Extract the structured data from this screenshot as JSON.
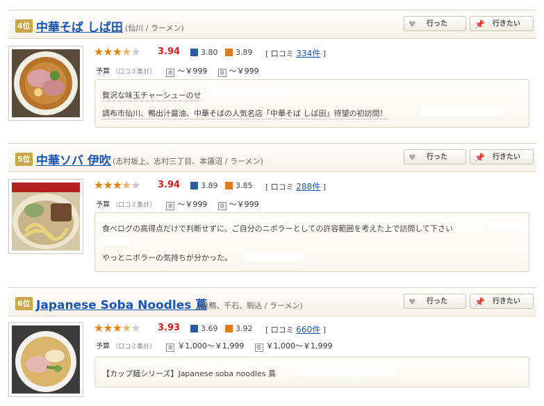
{
  "colors": {
    "link": "#1a55b0",
    "score": "#d01d1d",
    "star": "#e2830f",
    "rank_bg": "#c9a54b"
  },
  "buttons": {
    "went": "行った",
    "want": "行きたい",
    "went_icon": "heart-icon",
    "want_icon": "pin-icon"
  },
  "budget_label": "予算",
  "budget_note": "（口コミ集計）",
  "review_label": "口コミ",
  "entries": [
    {
      "rank": "4位",
      "name": "中華そば しば田",
      "area": "(仙川 / ラーメン)",
      "rating": 3.5,
      "score": "3.94",
      "dinner_score": "3.80",
      "lunch_score": "3.89",
      "reviews": "334件",
      "dinner_price": "～￥999",
      "lunch_price": "～￥999",
      "comments": [
        "贅沢な味玉チャーシューのせ",
        "調布市仙川、鴨出汁醤油、中華そばの人気名店「中華そば しば田」待望の初訪問！"
      ]
    },
    {
      "rank": "5位",
      "name": "中華ソバ 伊吹",
      "area": "(志村坂上、志村三丁目、本蓮沼 / ラーメン)",
      "rating": 3.5,
      "score": "3.94",
      "dinner_score": "3.89",
      "lunch_score": "3.85",
      "reviews": "288件",
      "dinner_price": "～￥999",
      "lunch_price": "～￥999",
      "comments": [
        "食べログの高得点だけで判断せずに、ご自分のニボラーとしての許容範囲を考えた上で訪問して下さい",
        "やっとニボラーの気持ちが分かった。"
      ]
    },
    {
      "rank": "6位",
      "name": "Japanese Soba Noodles 蔦",
      "area": "(巣鴨、千石、駒込 / ラーメン)",
      "rating": 3.5,
      "score": "3.93",
      "dinner_score": "3.69",
      "lunch_score": "3.92",
      "reviews": "660件",
      "dinner_price": "￥1,000～￥1,999",
      "lunch_price": "￥1,000～￥1,999",
      "comments": [
        "【カップ麺シリーズ】Japanese soba noodles 蔦"
      ]
    }
  ]
}
